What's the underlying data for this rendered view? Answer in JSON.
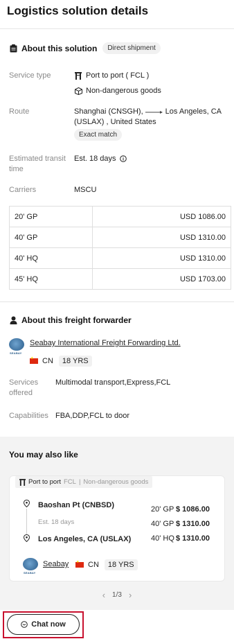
{
  "header": {
    "title": "Logistics solution details"
  },
  "about_solution": {
    "title": "About this solution",
    "badge": "Direct shipment",
    "service_type_label": "Service type",
    "service_type_values": [
      "Port to port ( FCL )",
      "Non-dangerous goods"
    ],
    "route_label": "Route",
    "route_origin": "Shanghai (CNSGH),",
    "route_dest": "Los Angeles, CA",
    "route_line2": "(USLAX) , United States",
    "route_match": "Exact match",
    "transit_label": "Estimated transit time",
    "transit_label_l1": "Estimated transit",
    "transit_label_l2": "time",
    "transit_value": "Est. 18 days",
    "carriers_label": "Carriers",
    "carriers_value": "MSCU",
    "prices": [
      {
        "container": "20' GP",
        "price": "USD  1086.00"
      },
      {
        "container": "40' GP",
        "price": "USD  1310.00"
      },
      {
        "container": "40' HQ",
        "price": "USD  1310.00"
      },
      {
        "container": "45' HQ",
        "price": "USD  1703.00"
      }
    ]
  },
  "forwarder": {
    "title": "About this freight forwarder",
    "name": "Seabay International Freight Forwarding Ltd.",
    "logo_text": "SEABAY",
    "country": "CN",
    "years": "18 YRS",
    "services_label_l1": "Services",
    "services_label_l2": "offered",
    "services_value": "Multimodal transport,Express,FCL",
    "capabilities_label": "Capabilities",
    "capabilities_value": "FBA,DDP,FCL to door"
  },
  "also_like": {
    "title": "You may also like",
    "card": {
      "tag_service": "Port to port",
      "tag_mode": "FCL",
      "tag_sep": "|",
      "tag_goods": "Non-dangerous goods",
      "origin": "Baoshan Pt (CNBSD)",
      "transit": "Est. 18 days",
      "dest": "Los Angeles, CA (USLAX)",
      "prices": [
        {
          "container": "20' GP",
          "price": "$ 1086.00"
        },
        {
          "container": "40' GP",
          "price": "$ 1310.00"
        },
        {
          "container": "40' HQ",
          "price": "$ 1310.00"
        }
      ],
      "company": "Seabay",
      "logo_text": "SEABAY",
      "country": "CN",
      "years": "18 YRS"
    },
    "pager": {
      "prev": "‹",
      "text": "1/3",
      "next": "›"
    }
  },
  "chat": {
    "label": "Chat now"
  },
  "colors": {
    "accent_red": "#c8102e",
    "flag_red": "#de2910"
  }
}
